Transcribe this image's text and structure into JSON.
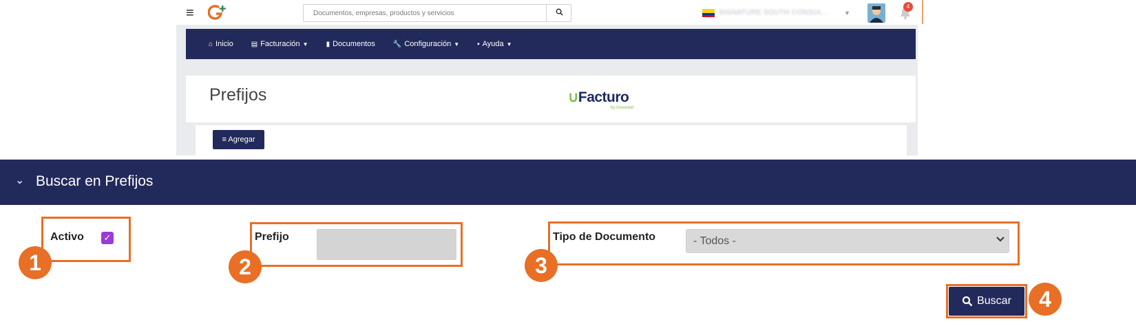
{
  "topbar": {
    "menu_icon": "hamburger-icon",
    "logo_icon": "g-plus-logo-icon",
    "search_placeholder": "Documentos, empresas, productos y servicios",
    "search_icon": "search-icon",
    "company_name": "SIGNATURE SOUTH CONSUL...",
    "flag_icon": "colombia-flag-icon",
    "notifications_count": "4"
  },
  "nav": {
    "items": [
      {
        "label": "Inicio",
        "icon": "home-icon"
      },
      {
        "label": "Facturación",
        "icon": "list-icon"
      },
      {
        "label": "Documentos",
        "icon": "document-icon"
      },
      {
        "label": "Configuración",
        "icon": "wrench-icon"
      },
      {
        "label": "Ayuda",
        "icon": "book-icon"
      }
    ]
  },
  "page": {
    "title": "Prefijos",
    "brand": "Facturo",
    "brand_sub": "by Gosocket",
    "add_button": "Agregar"
  },
  "search_panel": {
    "title": "Buscar en Prefijos",
    "activo_label": "Activo",
    "activo_checked": true,
    "prefijo_label": "Prefijo",
    "prefijo_value": "",
    "tipo_label": "Tipo de Documento",
    "tipo_selected": "- Todos -",
    "buscar_button": "Buscar"
  },
  "callouts": [
    "1",
    "2",
    "3",
    "4"
  ],
  "colors": {
    "navy": "#222a5b",
    "accent_orange": "#e86f25",
    "checkbox_purple": "#9b3bd6",
    "brand_green": "#7bc142"
  }
}
